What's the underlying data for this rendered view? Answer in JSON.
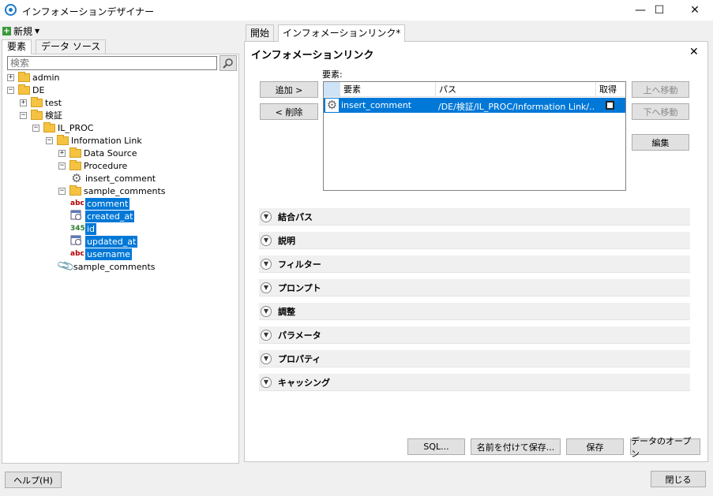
{
  "window": {
    "title": "インフォメーションデザイナー",
    "minimize": "—",
    "maximize": "☐",
    "close": "✕"
  },
  "left": {
    "new_label": "新規",
    "tabs": [
      "要素",
      "データ ソース"
    ],
    "search_placeholder": "検索",
    "tree": [
      {
        "label": "admin"
      },
      {
        "label": "DE"
      },
      {
        "label": "test"
      },
      {
        "label": "検証"
      },
      {
        "label": "IL_PROC"
      },
      {
        "label": "Information Link"
      },
      {
        "label": "Data Source"
      },
      {
        "label": "Procedure"
      },
      {
        "label": "insert_comment"
      },
      {
        "label": "sample_comments"
      },
      {
        "label": "comment",
        "type": "abc"
      },
      {
        "label": "created_at"
      },
      {
        "label": "id",
        "type": "345"
      },
      {
        "label": "updated_at"
      },
      {
        "label": "username",
        "type": "abc"
      },
      {
        "label": "sample_comments"
      }
    ]
  },
  "right": {
    "tabs": [
      "開始",
      "インフォメーションリンク*"
    ],
    "panel_title": "インフォメーションリンク",
    "add_label": "追加 >",
    "remove_label": "< 削除",
    "elements_label": "要素:",
    "columns": [
      "要素",
      "パス",
      "取得"
    ],
    "row": {
      "element": "insert_comment",
      "path": "/DE/検証/IL_PROC/Information Link/..."
    },
    "move_up": "上へ移動",
    "move_down": "下へ移動",
    "edit": "編集",
    "sections": [
      "結合パス",
      "説明",
      "フィルター",
      "プロンプト",
      "調整",
      "パラメータ",
      "プロパティ",
      "キャッシング"
    ],
    "bottom_buttons": {
      "sql": "SQL...",
      "save_as": "名前を付けて保存...",
      "save": "保存",
      "open_data": "データのオープン"
    }
  },
  "footer": {
    "help": "ヘルプ(H)",
    "close": "閉じる"
  }
}
